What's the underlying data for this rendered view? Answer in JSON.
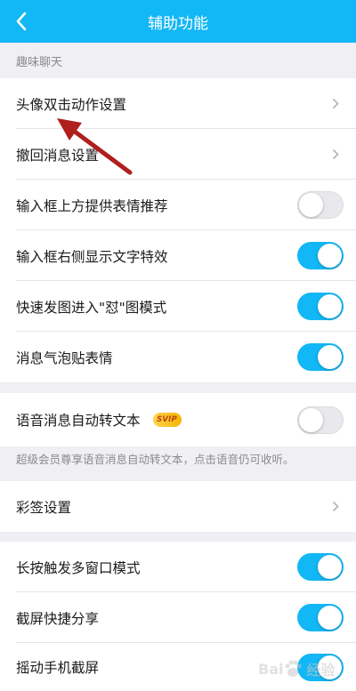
{
  "header": {
    "title": "辅助功能",
    "back_icon": "back-chevron-icon",
    "background": "#12b7f5"
  },
  "sections": {
    "fun_chat_label": "趣味聊天"
  },
  "rows": {
    "avatar_double_click": {
      "label": "头像双击动作设置",
      "type": "link"
    },
    "recall_message": {
      "label": "撤回消息设置",
      "type": "link"
    },
    "emoji_recommend": {
      "label": "输入框上方提供表情推荐",
      "type": "toggle",
      "on": false
    },
    "text_effect": {
      "label": "输入框右侧显示文字特效",
      "type": "toggle",
      "on": true
    },
    "quick_send_mode": {
      "label": "快速发图进入\"怼\"图模式",
      "type": "toggle",
      "on": true
    },
    "bubble_sticker": {
      "label": "消息气泡贴表情",
      "type": "toggle",
      "on": true
    },
    "voice_to_text": {
      "label": "语音消息自动转文本",
      "badge": "SVIP",
      "type": "toggle",
      "on": false
    },
    "color_tag": {
      "label": "彩签设置",
      "type": "link"
    },
    "long_press_multiwindow": {
      "label": "长按触发多窗口模式",
      "type": "toggle",
      "on": true
    },
    "screenshot_share": {
      "label": "截屏快捷分享",
      "type": "toggle",
      "on": true
    },
    "shake_screenshot": {
      "label": "摇动手机截屏",
      "type": "toggle",
      "on": true
    }
  },
  "notes": {
    "voice_note": "超级会员尊享语音消息自动转文本，点击语音仍可收听。"
  },
  "colors": {
    "accent": "#12b7f5",
    "annotation_arrow": "#b01e1e",
    "toggle_off": "#e8e8ed"
  },
  "watermark": {
    "text": "Bai",
    "text2": "经验",
    "icon": "baidu-paw-icon"
  }
}
